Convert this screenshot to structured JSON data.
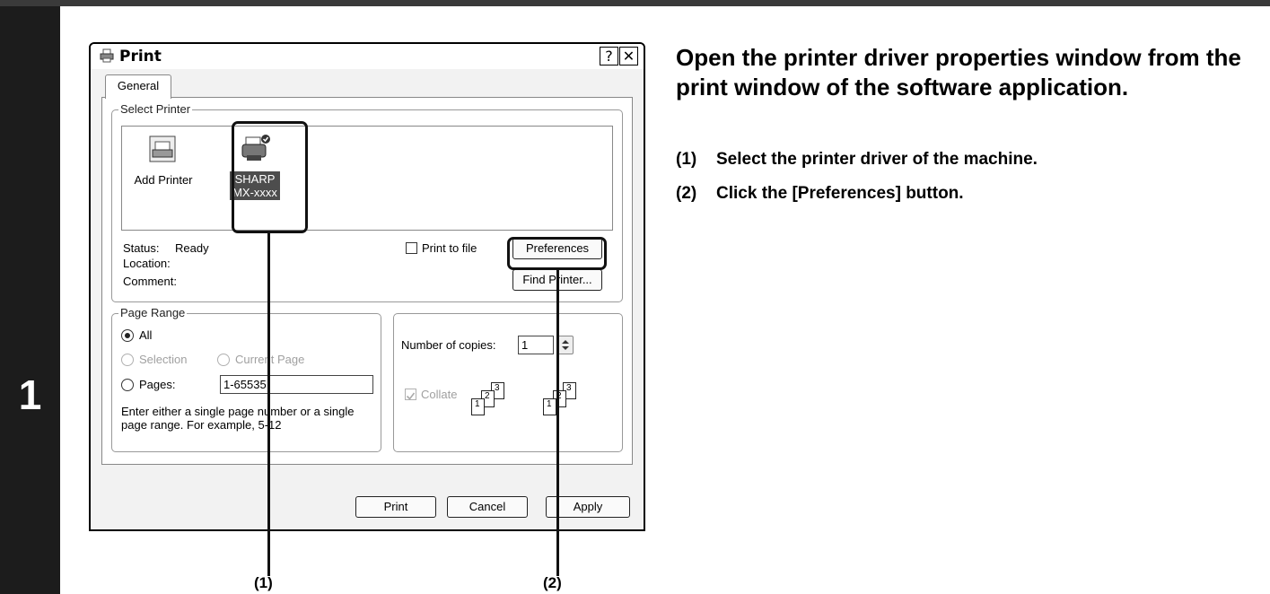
{
  "step": {
    "number": "1"
  },
  "instructions": {
    "heading": "Open the printer driver properties window from the print window of the software application.",
    "step1_num": "(1)",
    "step1_text": "Select the printer driver of the machine.",
    "step2_num": "(2)",
    "step2_text": "Click the [Preferences] button."
  },
  "dialog": {
    "title": "Print",
    "help_button": "?",
    "close_button": "✕",
    "tab_general": "General",
    "select_printer": {
      "legend": "Select Printer",
      "add_printer": "Add Printer",
      "selected_printer_line1": "SHARP",
      "selected_printer_line2": "MX-xxxx",
      "status_label": "Status:",
      "status_value": "Ready",
      "location_label": "Location:",
      "comment_label": "Comment:",
      "print_to_file": "Print to file",
      "preferences_button": "Preferences",
      "find_printer_button": "Find Printer..."
    },
    "page_range": {
      "legend": "Page Range",
      "all": "All",
      "selection": "Selection",
      "current_page": "Current Page",
      "pages": "Pages:",
      "pages_value": "1-65535",
      "hint": "Enter either a single page number or a single page range.  For example, 5-12"
    },
    "copies": {
      "label": "Number of copies:",
      "value": "1",
      "collate": "Collate",
      "sheets": [
        "1",
        "2",
        "3"
      ]
    },
    "buttons": {
      "print": "Print",
      "cancel": "Cancel",
      "apply": "Apply"
    }
  },
  "callouts": {
    "label1": "(1)",
    "label2": "(2)"
  }
}
